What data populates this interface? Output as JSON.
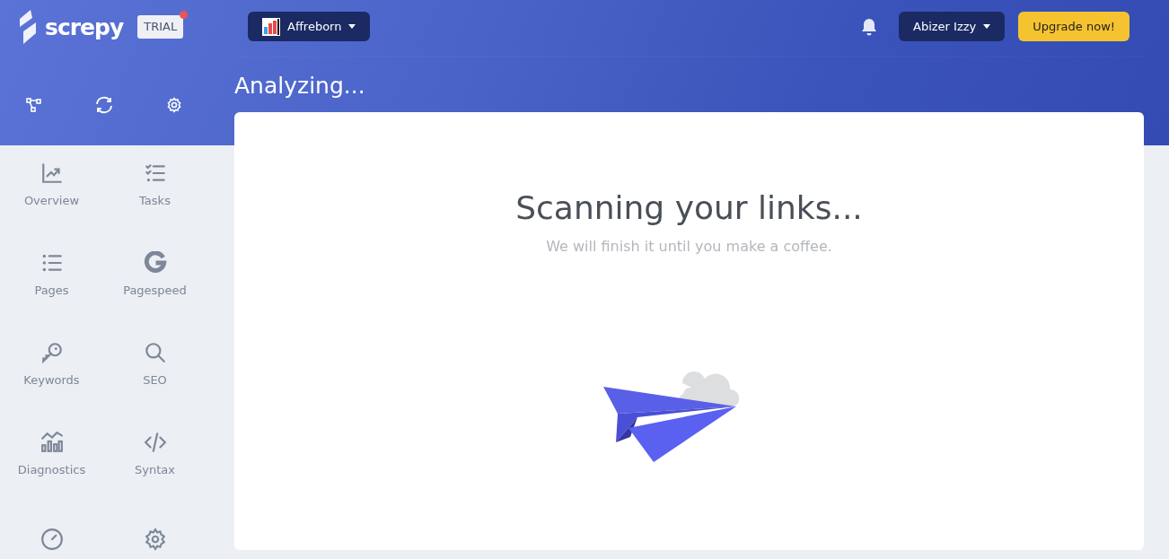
{
  "brand": {
    "name": "screpy",
    "badge": "TRIAL",
    "badge_dot": true
  },
  "project": {
    "name": "Affreborn"
  },
  "user": {
    "name": "Abizer Izzy"
  },
  "upgrade": {
    "label": "Upgrade now!"
  },
  "page_title": "Analyzing...",
  "sidebar": {
    "items": [
      {
        "label": "Overview"
      },
      {
        "label": "Tasks"
      },
      {
        "label": "Pages"
      },
      {
        "label": "Pagespeed"
      },
      {
        "label": "Keywords"
      },
      {
        "label": "SEO"
      },
      {
        "label": "Diagnostics"
      },
      {
        "label": "Syntax"
      }
    ]
  },
  "scan": {
    "title": "Scanning your links...",
    "subtitle": "We will finish it until you make a coffee."
  }
}
